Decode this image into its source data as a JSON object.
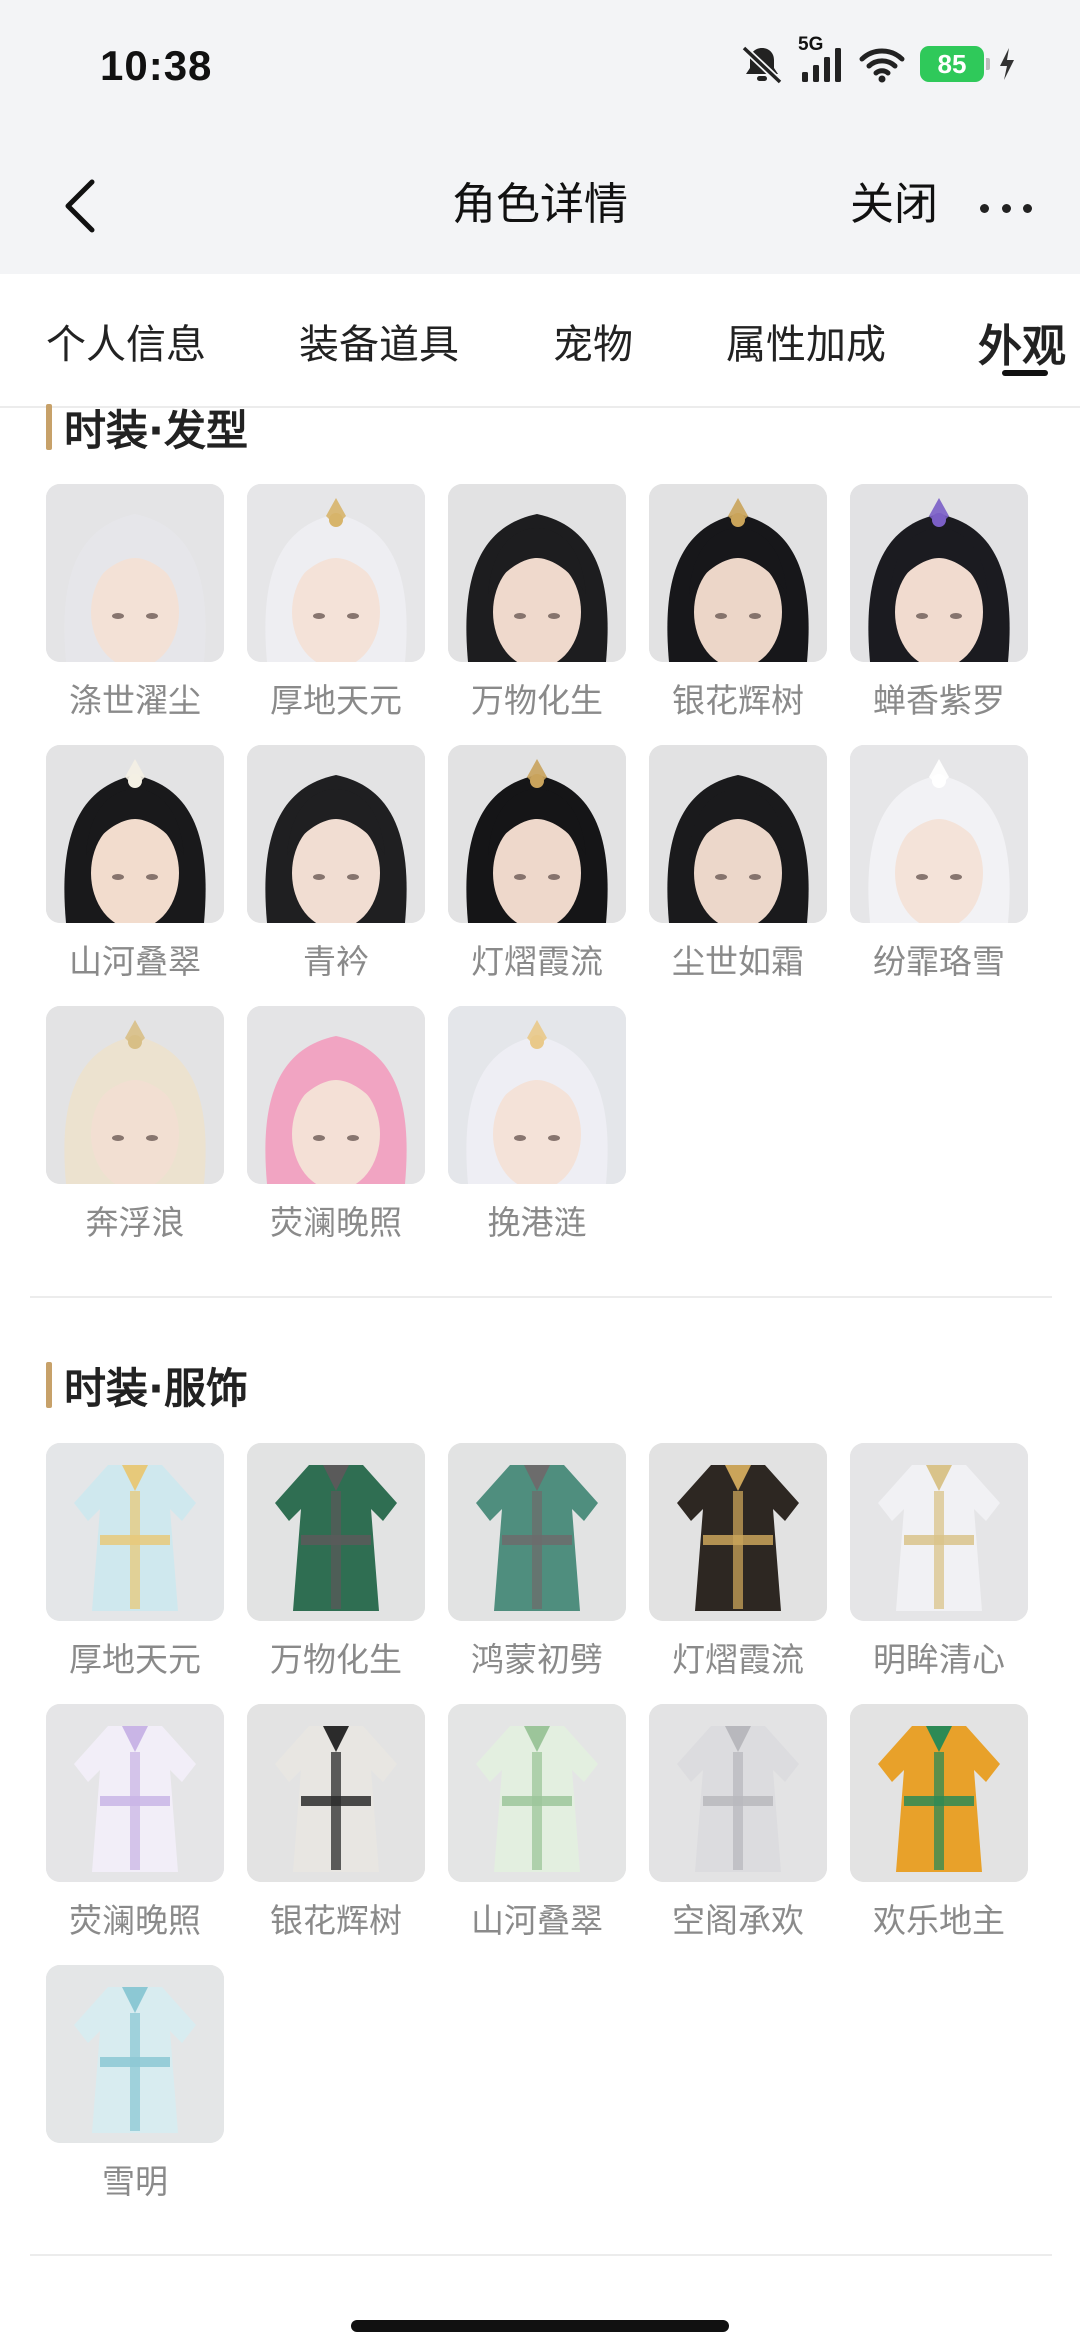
{
  "status": {
    "time": "10:38",
    "network": "5G",
    "battery": "85"
  },
  "nav": {
    "title": "角色详情",
    "close_label": "关闭"
  },
  "tabs": [
    {
      "label": "个人信息"
    },
    {
      "label": "装备道具"
    },
    {
      "label": "宠物"
    },
    {
      "label": "属性加成"
    },
    {
      "label": "外观"
    }
  ],
  "sections": {
    "hair": {
      "title": "时装·发型",
      "items": [
        {
          "label": "涤世濯尘",
          "hair": "#e6e6ea",
          "skin": "#f3e1d6",
          "bg": "#e4e4e6",
          "ornament": "none"
        },
        {
          "label": "厚地天元",
          "hair": "#eeeef2",
          "skin": "#f4e2d8",
          "bg": "#e6e6e8",
          "ornament": "#d7b46a"
        },
        {
          "label": "万物化生",
          "hair": "#1d1d1f",
          "skin": "#efd9cc",
          "bg": "#e2e2e3",
          "ornament": "none"
        },
        {
          "label": "银花辉树",
          "hair": "#17171a",
          "skin": "#ecd6c8",
          "bg": "#e2e2e3",
          "ornament": "#caa45a"
        },
        {
          "label": "蝉香紫罗",
          "hair": "#1b1b20",
          "skin": "#f1dbcf",
          "bg": "#e2e2e4",
          "ornament": "#7b5fc6"
        },
        {
          "label": "山河叠翠",
          "hair": "#19191b",
          "skin": "#f2dccd",
          "bg": "#e3e3e4",
          "ornament": "#f4f0e4"
        },
        {
          "label": "青衿",
          "hair": "#1f1f21",
          "skin": "#f1ddd2",
          "bg": "#e3e3e4",
          "ornament": "none"
        },
        {
          "label": "灯熠霞流",
          "hair": "#151517",
          "skin": "#eed8cb",
          "bg": "#e2e2e3",
          "ornament": "#c9a35c"
        },
        {
          "label": "尘世如霜",
          "hair": "#1a1a1c",
          "skin": "#ecd7ca",
          "bg": "#e2e2e3",
          "ornament": "none"
        },
        {
          "label": "纷霏珞雪",
          "hair": "#f2f2f5",
          "skin": "#f4e3d9",
          "bg": "#e6e6e8",
          "ornament": "#ffffff"
        },
        {
          "label": "奔浮浪",
          "hair": "#ece2cf",
          "skin": "#f2dfd2",
          "bg": "#e3e3e4",
          "ornament": "#d8bf86"
        },
        {
          "label": "荧澜晚照",
          "hair": "#f1a4c2",
          "skin": "#f4e0d6",
          "bg": "#e4e4e6",
          "ornament": "none"
        },
        {
          "label": "挽港涟",
          "hair": "#eeeef4",
          "skin": "#f4e2d8",
          "bg": "#e4e6ea",
          "ornament": "#e9c98a"
        }
      ]
    },
    "outfit": {
      "title": "时装·服饰",
      "items": [
        {
          "label": "厚地天元",
          "main": "#cfe8ee",
          "accent": "#e7c97a",
          "bg": "#e4e6e8"
        },
        {
          "label": "万物化生",
          "main": "#2f6e52",
          "accent": "#5a5a5a",
          "bg": "#e2e3e3"
        },
        {
          "label": "鸿蒙初劈",
          "main": "#4f8e7e",
          "accent": "#6c6c6c",
          "bg": "#e2e3e3"
        },
        {
          "label": "灯熠霞流",
          "main": "#2d2722",
          "accent": "#caa45a",
          "bg": "#e2e2e2"
        },
        {
          "label": "明眸清心",
          "main": "#f1f1f4",
          "accent": "#d9c38a",
          "bg": "#e5e5e7"
        },
        {
          "label": "荧澜晚照",
          "main": "#f2eef8",
          "accent": "#c9b5e6",
          "bg": "#e5e5e7"
        },
        {
          "label": "银花辉树",
          "main": "#e8e6e2",
          "accent": "#2b2b2b",
          "bg": "#e3e3e3"
        },
        {
          "label": "山河叠翠",
          "main": "#e3efe0",
          "accent": "#9cc59a",
          "bg": "#e4e5e5"
        },
        {
          "label": "空阁承欢",
          "main": "#dcdcdf",
          "accent": "#b8b8bd",
          "bg": "#e3e3e4"
        },
        {
          "label": "欢乐地主",
          "main": "#e8a12a",
          "accent": "#2d8a55",
          "bg": "#e3e3e3"
        },
        {
          "label": "雪明",
          "main": "#d8ecf0",
          "accent": "#8cc8d4",
          "bg": "#e4e6e7"
        }
      ]
    }
  }
}
